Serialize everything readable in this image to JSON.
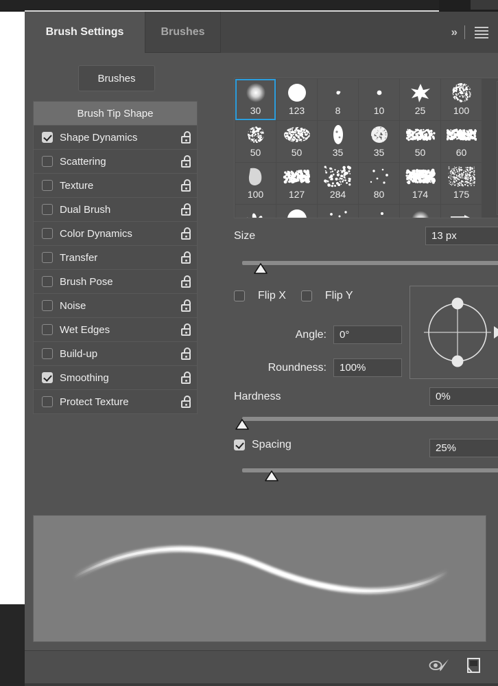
{
  "panel": {
    "tabs": [
      {
        "label": "Brush Settings",
        "active": true
      },
      {
        "label": "Brushes",
        "active": false
      }
    ],
    "collapse_icon": "chevron-double-right-icon",
    "menu_icon": "panel-menu-icon",
    "brushes_button": "Brushes"
  },
  "settings": {
    "header": "Brush Tip Shape",
    "items": [
      {
        "label": "Shape Dynamics",
        "checked": true,
        "lock": "unlocked"
      },
      {
        "label": "Scattering",
        "checked": false,
        "lock": "unlocked"
      },
      {
        "label": "Texture",
        "checked": false,
        "lock": "unlocked"
      },
      {
        "label": "Dual Brush",
        "checked": false,
        "lock": "unlocked"
      },
      {
        "label": "Color Dynamics",
        "checked": false,
        "lock": "unlocked"
      },
      {
        "label": "Transfer",
        "checked": false,
        "lock": "unlocked"
      },
      {
        "label": "Brush Pose",
        "checked": false,
        "lock": "unlocked"
      },
      {
        "label": "Noise",
        "checked": false,
        "lock": "unlocked"
      },
      {
        "label": "Wet Edges",
        "checked": false,
        "lock": "unlocked"
      },
      {
        "label": "Build-up",
        "checked": false,
        "lock": "unlocked"
      },
      {
        "label": "Smoothing",
        "checked": true,
        "lock": "unlocked"
      },
      {
        "label": "Protect Texture",
        "checked": false,
        "lock": "unlocked"
      }
    ]
  },
  "brush_grid": {
    "selected_index": 0,
    "scrollbar": "vertical-scrollbar",
    "presets": [
      {
        "size": "30",
        "kind": "soft-round"
      },
      {
        "size": "123",
        "kind": "hard-round"
      },
      {
        "size": "8",
        "kind": "tiny-speck"
      },
      {
        "size": "10",
        "kind": "small-dot"
      },
      {
        "size": "25",
        "kind": "star-splatter"
      },
      {
        "size": "100",
        "kind": "noise-round"
      },
      {
        "size": "50",
        "kind": "grain-round"
      },
      {
        "size": "50",
        "kind": "soft-oval-grain"
      },
      {
        "size": "35",
        "kind": "vertical-blob"
      },
      {
        "size": "35",
        "kind": "fuzzy-round"
      },
      {
        "size": "50",
        "kind": "rough-streak"
      },
      {
        "size": "60",
        "kind": "rough-streak-wide"
      },
      {
        "size": "100",
        "kind": "thumb-smudge"
      },
      {
        "size": "127",
        "kind": "dry-brush"
      },
      {
        "size": "284",
        "kind": "spatter"
      },
      {
        "size": "80",
        "kind": "sparse-dots"
      },
      {
        "size": "174",
        "kind": "chalk-stroke"
      },
      {
        "size": "175",
        "kind": "hair-comb"
      },
      {
        "size": "",
        "kind": "leaf-scatter"
      },
      {
        "size": "",
        "kind": "hard-round-large"
      },
      {
        "size": "",
        "kind": "dot-scatter-a"
      },
      {
        "size": "",
        "kind": "dot-scatter-b"
      },
      {
        "size": "",
        "kind": "soft-glow"
      },
      {
        "size": "",
        "kind": "flat-marker"
      }
    ]
  },
  "controls": {
    "size": {
      "label": "Size",
      "value": "13 px",
      "slider_pct": 7
    },
    "flip_x": {
      "label": "Flip X",
      "checked": false
    },
    "flip_y": {
      "label": "Flip Y",
      "checked": false
    },
    "angle": {
      "label": "Angle:",
      "value": "0°"
    },
    "roundness": {
      "label": "Roundness:",
      "value": "100%"
    },
    "angle_widget": "angle-roundness-dial",
    "hardness": {
      "label": "Hardness",
      "value": "0%",
      "slider_pct": 0
    },
    "spacing": {
      "label": "Spacing",
      "value": "25%",
      "checked": true,
      "slider_pct": 11
    }
  },
  "preview": {
    "name": "brush-stroke-preview"
  },
  "footer": {
    "live_tip_icon": "live-brush-tip-preview-icon",
    "new_brush_icon": "create-new-brush-icon"
  },
  "colors": {
    "panel_bg": "#535353",
    "tab_bg": "#454545",
    "accent": "#2c9ede",
    "field_bg": "#464646",
    "text": "#efefef",
    "preview_bg": "#7d7d7d"
  }
}
